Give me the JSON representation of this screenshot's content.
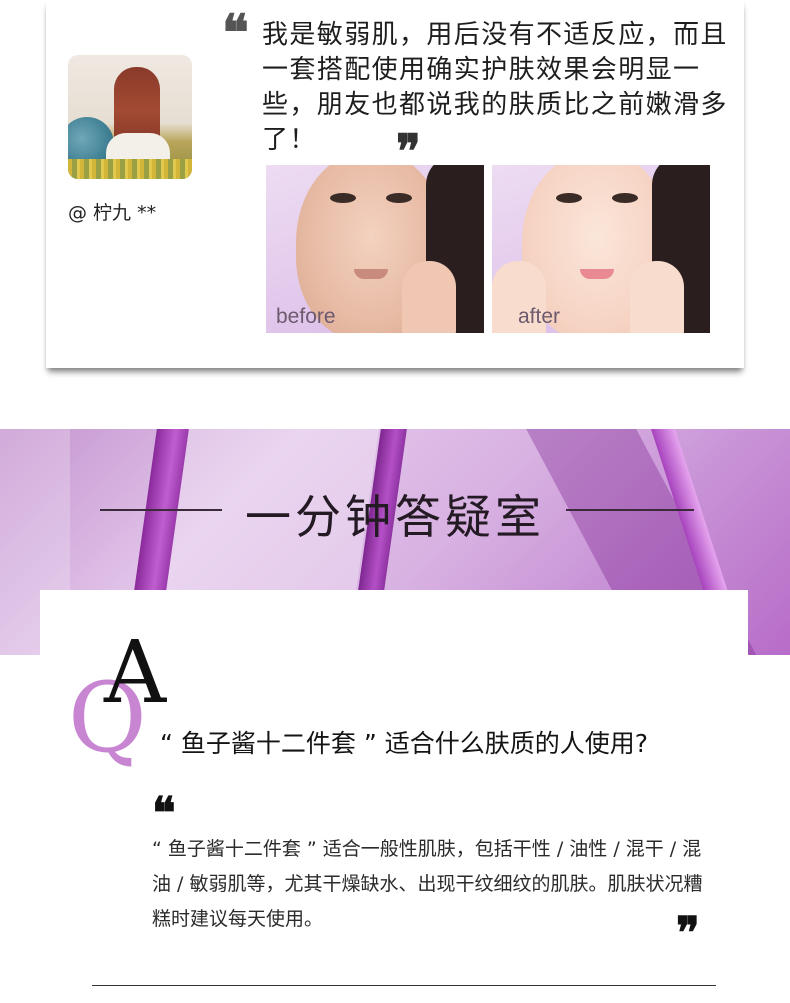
{
  "review": {
    "username": "@ 柠九 **",
    "quote_open": "❝",
    "quote_close": "❞",
    "text": "我是敏弱肌，用后没有不适反应，而且一套搭配使用确实护肤效果会明显一些，朋友也都说我的肤质比之前嫩滑多了！",
    "photos": [
      {
        "label": "before"
      },
      {
        "label": "after"
      }
    ]
  },
  "faq": {
    "title": "一分钟答疑室",
    "letter_a": "A",
    "letter_q": "Q",
    "question": "“ 鱼子酱十二件套 ” 适合什么肤质的人使用?",
    "quote_open": "❝",
    "quote_close": "❞",
    "answer": "“ 鱼子酱十二件套 ” 适合一般性肌肤，包括干性 / 油性 / 混干 / 混油 / 敏弱肌等，尤其干燥缺水、出现干纹细纹的肌肤。肌肤状况糟糕时建议每天使用。"
  },
  "colors": {
    "accent_purple": "#c785d2",
    "banner_purple": "#b86cc8"
  }
}
